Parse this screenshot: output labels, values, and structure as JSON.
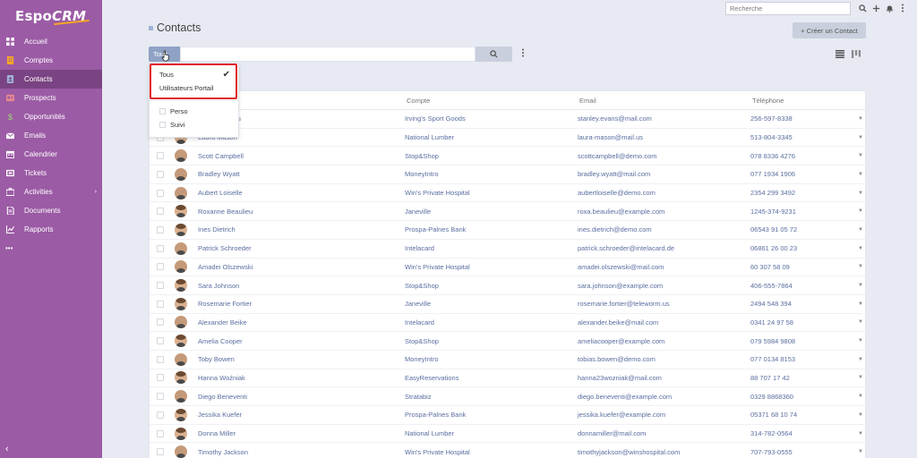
{
  "app": {
    "logo_main": "Espo",
    "logo_accent": "CRM"
  },
  "sidebar": {
    "items": [
      {
        "label": "Accueil",
        "icon": "home-icon",
        "color": "#ffffff"
      },
      {
        "label": "Comptes",
        "icon": "building-icon",
        "color": "#f5a623"
      },
      {
        "label": "Contacts",
        "icon": "contact-card-icon",
        "color": "#9fb4d8",
        "active": true
      },
      {
        "label": "Prospects",
        "icon": "id-card-icon",
        "color": "#e88a8a"
      },
      {
        "label": "Opportunités",
        "icon": "dollar-icon",
        "color": "#9bd36f"
      },
      {
        "label": "Emails",
        "icon": "envelope-icon",
        "color": "#ffffff"
      },
      {
        "label": "Calendrier",
        "icon": "calendar-icon",
        "color": "#ffffff"
      },
      {
        "label": "Tickets",
        "icon": "ticket-icon",
        "color": "#ffffff"
      },
      {
        "label": "Activities",
        "icon": "briefcase-icon",
        "color": "#ffffff",
        "has_submenu": true
      },
      {
        "label": "Documents",
        "icon": "document-icon",
        "color": "#ffffff"
      },
      {
        "label": "Rapports",
        "icon": "chart-icon",
        "color": "#ffffff"
      }
    ],
    "more_label": "•••",
    "collapse_label": "‹"
  },
  "topbar": {
    "search_placeholder": "Recherche"
  },
  "header": {
    "title": "Contacts",
    "create_button": "+ Créer un Contact"
  },
  "filter": {
    "button_label": "Tous",
    "menu": {
      "primary": [
        {
          "label": "Tous",
          "checked": true
        },
        {
          "label": "Utilisateurs Portail",
          "checked": false
        }
      ],
      "boolean": [
        {
          "label": "Perso"
        },
        {
          "label": "Suivi"
        }
      ]
    }
  },
  "table": {
    "headers": {
      "name": "Nom",
      "account": "Compte",
      "email": "Email",
      "phone": "Téléphone"
    },
    "rows": [
      {
        "name": "Stanley Evans",
        "account": "Irving's Sport Goods",
        "email": "stanley.evans@mail.com",
        "phone": "256-597-8338",
        "gender": "m"
      },
      {
        "name": "Laura Mason",
        "account": "National Lumber",
        "email": "laura-mason@mail.us",
        "phone": "513-804-3345",
        "gender": "f"
      },
      {
        "name": "Scott Campbell",
        "account": "Stop&Shop",
        "email": "scottcampbell@demo.com",
        "phone": "078 8336 4276",
        "gender": "m"
      },
      {
        "name": "Bradley Wyatt",
        "account": "MoneyIntro",
        "email": "bradley.wyatt@mail.com",
        "phone": "077 1934 1906",
        "gender": "m"
      },
      {
        "name": "Aubert Loiselle",
        "account": "Win's Private Hospital",
        "email": "aubertloiselle@demo.com",
        "phone": "2354 299 3492",
        "gender": "m"
      },
      {
        "name": "Roxanne Beaulieu",
        "account": "Janeville",
        "email": "roxa.beaulieu@example.com",
        "phone": "1245-374-9231",
        "gender": "f"
      },
      {
        "name": "Ines Dietrich",
        "account": "Prospa-Palnes Bank",
        "email": "ines.dietrich@demo.com",
        "phone": "06543 91 05 72",
        "gender": "f"
      },
      {
        "name": "Patrick Schroeder",
        "account": "Intelacard",
        "email": "patrick.schroeder@intelacard.de",
        "phone": "06861 26 00 23",
        "gender": "m"
      },
      {
        "name": "Amadei Olszewski",
        "account": "Win's Private Hospital",
        "email": "amadei.olszewski@mail.com",
        "phone": "60 307 58 09",
        "gender": "m"
      },
      {
        "name": "Sara Johnson",
        "account": "Stop&Shop",
        "email": "sara.johnson@example.com",
        "phone": "406-555-7864",
        "gender": "f"
      },
      {
        "name": "Rosemarie Fortier",
        "account": "Janeville",
        "email": "rosemarie.fortier@teleworm.us",
        "phone": "2494 548 394",
        "gender": "f"
      },
      {
        "name": "Alexander Beike",
        "account": "Intelacard",
        "email": "alexander.beike@mail.com",
        "phone": "0341 24 97 58",
        "gender": "m"
      },
      {
        "name": "Amelia Cooper",
        "account": "Stop&Shop",
        "email": "ameliacooper@example.com",
        "phone": "079 5984 9808",
        "gender": "f"
      },
      {
        "name": "Toby Bowen",
        "account": "MoneyIntro",
        "email": "tobias.bowen@demo.com",
        "phone": "077 0134 8153",
        "gender": "m"
      },
      {
        "name": "Hanna Woźniak",
        "account": "EasyReservations",
        "email": "hanna23wozniak@mail.com",
        "phone": "88 707 17 42",
        "gender": "f"
      },
      {
        "name": "Diego Beneventi",
        "account": "Stratabiz",
        "email": "diego.beneventi@example.com",
        "phone": "0329 8868360",
        "gender": "m"
      },
      {
        "name": "Jessika Kuefer",
        "account": "Prospa-Palnes Bank",
        "email": "jessika.kuefer@example.com",
        "phone": "05371 68 10 74",
        "gender": "f"
      },
      {
        "name": "Donna Miller",
        "account": "National Lumber",
        "email": "donnamiller@mail.com",
        "phone": "314-782-0564",
        "gender": "f"
      },
      {
        "name": "Timothy Jackson",
        "account": "Win's Private Hospital",
        "email": "timothyjackson@winshospital.com",
        "phone": "707-793-0555",
        "gender": "m"
      }
    ]
  },
  "colors": {
    "sidebar": "#9b5ba5",
    "sidebar_active": "#7a4383",
    "link": "#5a6ea0",
    "filter_button": "#8fa2c5",
    "highlight": "#e2232a"
  }
}
